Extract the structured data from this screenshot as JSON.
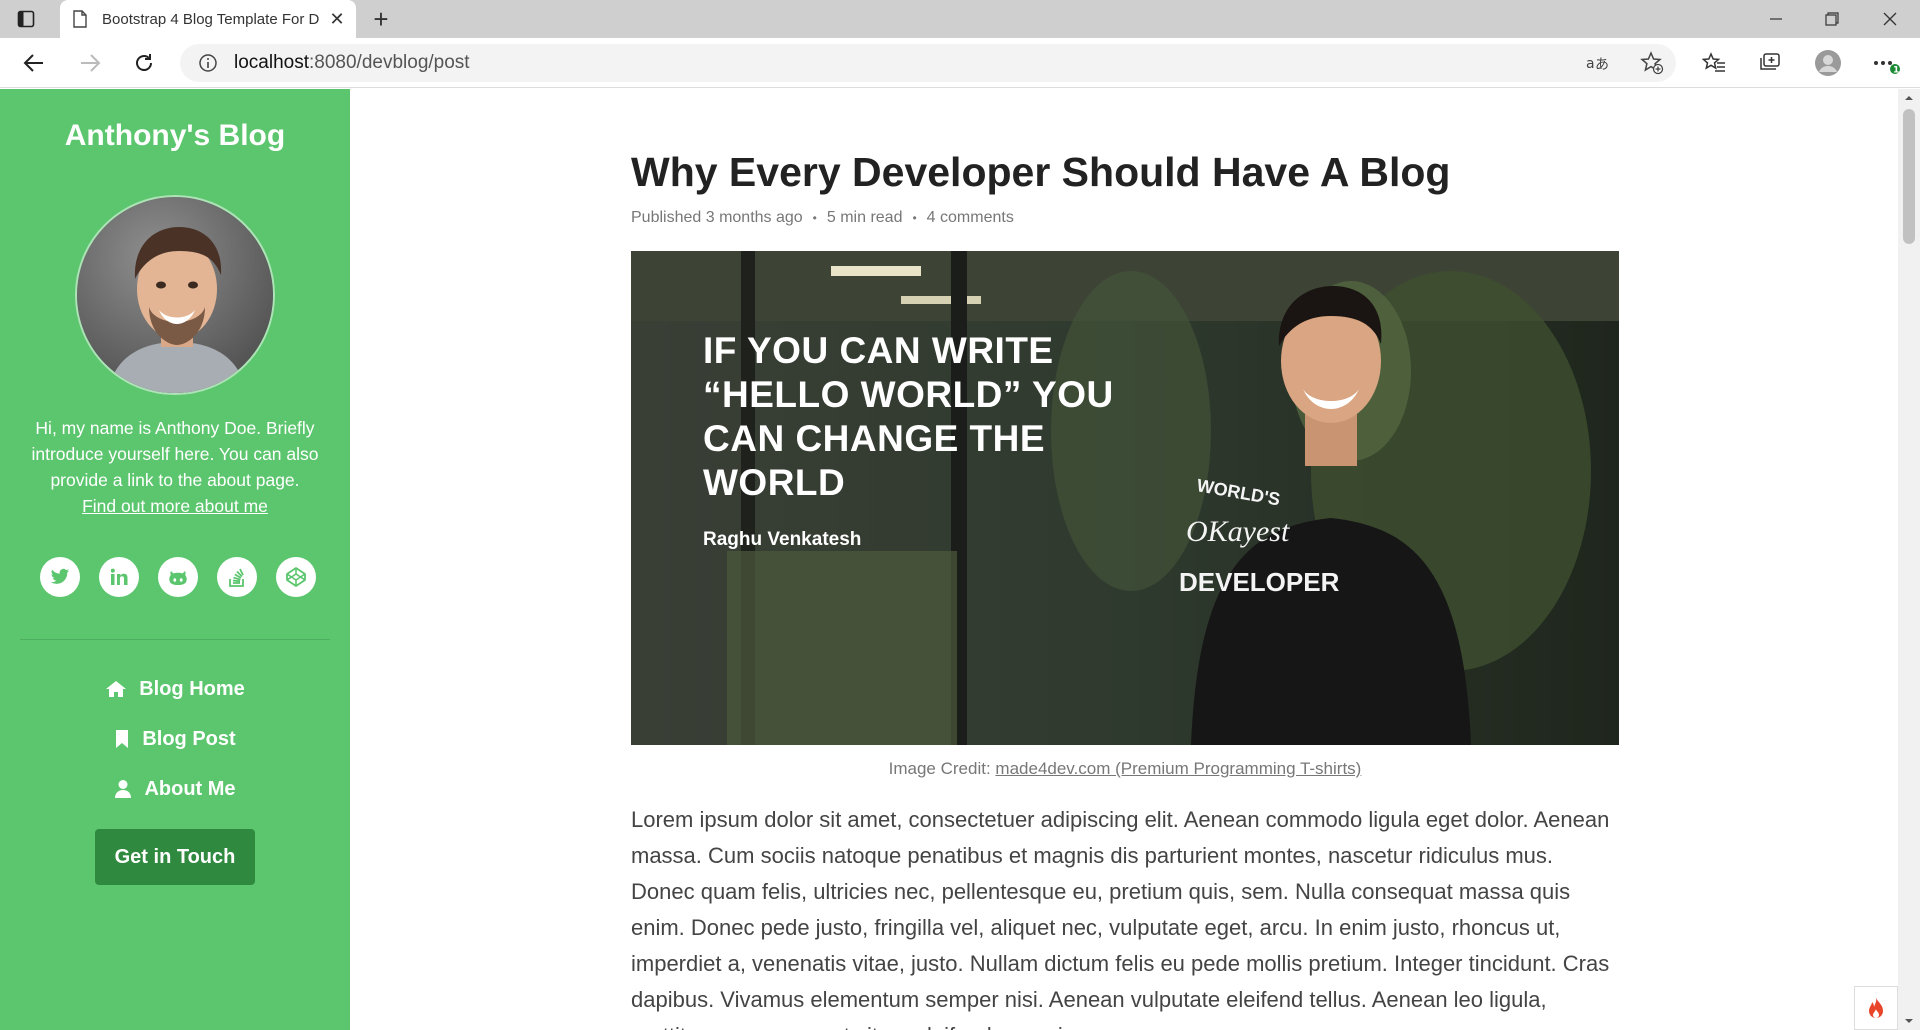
{
  "browser": {
    "tab_title": "Bootstrap 4 Blog Template For D",
    "url_host": "localhost",
    "url_path": ":8080/devblog/post",
    "icons": [
      "tab-actions-icon",
      "page-icon",
      "close-icon",
      "plus-icon",
      "minimize-icon",
      "restore-icon",
      "window-close-icon",
      "back-arrow-icon",
      "forward-arrow-icon",
      "refresh-icon",
      "info-icon",
      "read-aloud-icon",
      "add-favorite-icon",
      "favorites-icon",
      "collections-icon",
      "profile-icon",
      "more-icon"
    ]
  },
  "sidebar": {
    "blog_name": "Anthony's Blog",
    "intro": "Hi, my name is Anthony Doe. Briefly introduce yourself here. You can also provide a link to the about page.",
    "about_link": "Find out more about me",
    "social": [
      "twitter-icon",
      "linkedin-icon",
      "github-icon",
      "stack-overflow-icon",
      "codepen-icon"
    ],
    "nav": [
      {
        "label": "Blog Home",
        "icon": "home-icon"
      },
      {
        "label": "Blog Post",
        "icon": "bookmark-icon"
      },
      {
        "label": "About Me",
        "icon": "user-icon"
      }
    ],
    "cta": "Get in Touch",
    "bg_color": "#5cc66e",
    "cta_color": "#2f8a3f"
  },
  "post": {
    "title": "Why Every Developer Should Have A Blog",
    "published": "Published 3 months ago",
    "read_time": "5 min read",
    "comments": "4 comments",
    "dot": "•",
    "hero_quote": "IF YOU CAN WRITE “HELLO WORLD” YOU CAN CHANGE THE WORLD",
    "hero_author": "Raghu Venkatesh",
    "hero_shirt": "WORLD'S OKayest DEVELOPER",
    "caption_prefix": "Image Credit:",
    "caption_link": "made4dev.com (Premium Programming T-shirts)",
    "body": "Lorem ipsum dolor sit amet, consectetuer adipiscing elit. Aenean commodo ligula eget dolor. Aenean massa. Cum sociis natoque penatibus et magnis dis parturient montes, nascetur ridiculus mus. Donec quam felis, ultricies nec, pellentesque eu, pretium quis, sem. Nulla consequat massa quis enim. Donec pede justo, fringilla vel, aliquet nec, vulputate eget, arcu. In enim justo, rhoncus ut, imperdiet a, venenatis vitae, justo. Nullam dictum felis eu pede mollis pretium. Integer tincidunt. Cras dapibus. Vivamus elementum semper nisi. Aenean vulputate eleifend tellus. Aenean leo ligula, porttitor eu, consequat vitae, eleifend ac, enim."
  }
}
